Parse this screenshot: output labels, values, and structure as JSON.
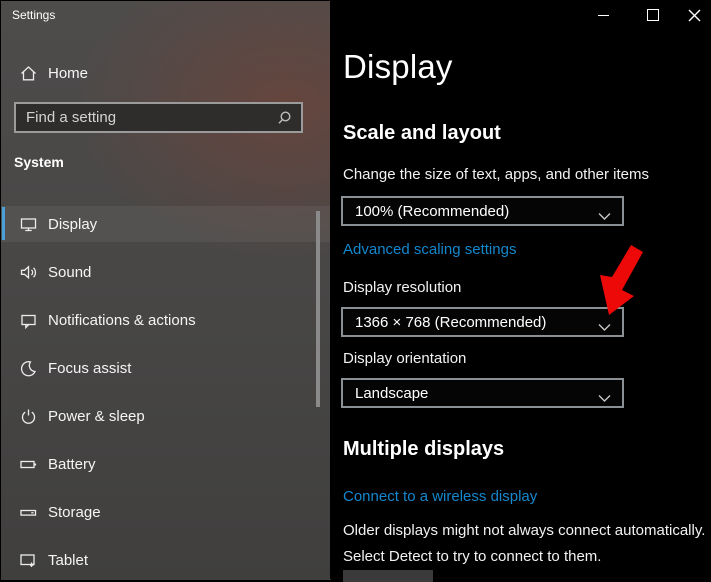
{
  "window": {
    "app_title": "Settings",
    "controls": [
      "minimize-icon",
      "maximize-icon",
      "close-icon"
    ]
  },
  "sidebar": {
    "home_label": "Home",
    "search_placeholder": "Find a setting",
    "search_icon": "search-icon",
    "section_label": "System",
    "items": [
      {
        "icon": "display-icon",
        "label": "Display",
        "selected": true
      },
      {
        "icon": "sound-icon",
        "label": "Sound",
        "selected": false
      },
      {
        "icon": "notifications-icon",
        "label": "Notifications & actions",
        "selected": false
      },
      {
        "icon": "focus-assist-icon",
        "label": "Focus assist",
        "selected": false
      },
      {
        "icon": "power-icon",
        "label": "Power & sleep",
        "selected": false
      },
      {
        "icon": "battery-icon",
        "label": "Battery",
        "selected": false
      },
      {
        "icon": "storage-icon",
        "label": "Storage",
        "selected": false
      },
      {
        "icon": "tablet-icon",
        "label": "Tablet",
        "selected": false
      }
    ]
  },
  "main": {
    "title": "Display",
    "scale": {
      "heading": "Scale and layout",
      "size_label": "Change the size of text, apps, and other items",
      "size_value": "100% (Recommended)",
      "advanced_link": "Advanced scaling settings",
      "resolution_label": "Display resolution",
      "resolution_value": "1366 × 768 (Recommended)",
      "orientation_label": "Display orientation",
      "orientation_value": "Landscape"
    },
    "multiple": {
      "heading": "Multiple displays",
      "wireless_link": "Connect to a wireless display",
      "note": "Older displays might not always connect automatically. Select Detect to try to connect to them."
    }
  },
  "annotation": {
    "red_arrow_points_at": "display-resolution-dropdown-chevron"
  },
  "colors": {
    "accent_blue": "#3f9bd8",
    "link_blue": "#1587cd",
    "arrow_red": "#ee0909",
    "sidebar_gray": "#474645",
    "content_black": "#000000"
  }
}
